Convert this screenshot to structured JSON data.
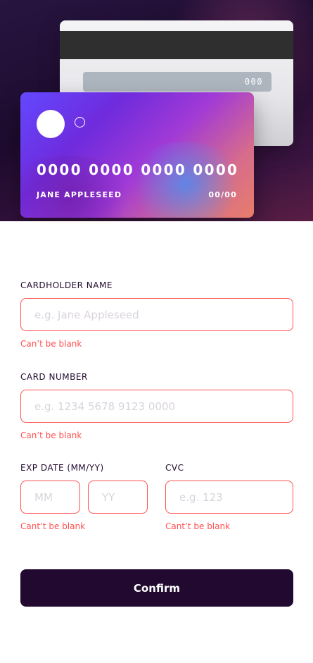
{
  "card_preview": {
    "back": {
      "cvc": "000"
    },
    "front": {
      "number": "0000 0000 0000 0000",
      "name": "JANE APPLESEED",
      "expiry": "00/00"
    }
  },
  "form": {
    "cardholder_name": {
      "label": "CARDHOLDER NAME",
      "value": "",
      "placeholder": "e.g. Jane Appleseed",
      "error": "Can’t be blank"
    },
    "card_number": {
      "label": "CARD NUMBER",
      "value": "",
      "placeholder": "e.g. 1234 5678 9123 0000",
      "error": "Can’t be blank"
    },
    "exp_date": {
      "label": "EXP DATE (MM/YY)",
      "month_placeholder": "MM",
      "year_placeholder": "YY",
      "error": "Cant’t be blank"
    },
    "cvc": {
      "label": "CVC",
      "placeholder": "e.g. 123",
      "error": "Cant’t be blank"
    },
    "confirm_label": "Confirm"
  },
  "colors": {
    "error": "#ff5050",
    "dark_violet": "#21092f",
    "placeholder": "#d9d4dc"
  }
}
